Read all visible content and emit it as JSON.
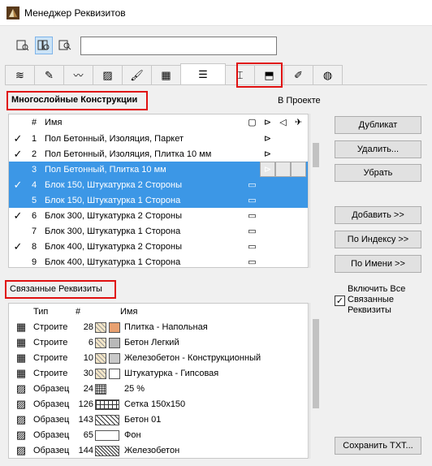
{
  "window": {
    "title": "Менеджер Реквизитов"
  },
  "search": {
    "value": ""
  },
  "top_section": {
    "title": "Многослойные Конструкции",
    "hint": "В Проекте"
  },
  "list_header": {
    "num": "#",
    "name": "Имя"
  },
  "items": [
    {
      "checked": true,
      "num": "1",
      "name": "Пол Бетонный, Изоляция, Паркет",
      "selected": false,
      "icon": "eye"
    },
    {
      "checked": true,
      "num": "2",
      "name": "Пол Бетонный, Изоляция, Плитка 10 мм",
      "selected": false,
      "icon": "eye"
    },
    {
      "checked": false,
      "num": "3",
      "name": "Пол Бетонный, Плитка 10 мм",
      "selected": true,
      "icon": "eye"
    },
    {
      "checked": true,
      "num": "4",
      "name": "Блок 150, Штукатурка 2 Стороны",
      "selected": true,
      "icon": "wall"
    },
    {
      "checked": false,
      "num": "5",
      "name": "Блок 150, Штукатурка 1 Сторона",
      "selected": true,
      "icon": "wall"
    },
    {
      "checked": true,
      "num": "6",
      "name": "Блок 300, Штукатурка 2 Стороны",
      "selected": false,
      "icon": "wall"
    },
    {
      "checked": false,
      "num": "7",
      "name": "Блок 300, Штукатурка 1 Сторона",
      "selected": false,
      "icon": "wall"
    },
    {
      "checked": true,
      "num": "8",
      "name": "Блок 400, Штукатурка 2 Стороны",
      "selected": false,
      "icon": "wall"
    },
    {
      "checked": false,
      "num": "9",
      "name": "Блок 400, Штукатурка 1 Сторона",
      "selected": false,
      "icon": "wall"
    }
  ],
  "buttons": {
    "duplicate": "Дубликат",
    "delete": "Удалить...",
    "remove": "Убрать",
    "add": "Добавить >>",
    "by_index": "По Индексу >>",
    "by_name": "По Имени >>",
    "save_txt": "Сохранить TXT..."
  },
  "bottom_section": {
    "title": "Связанные Реквизиты",
    "include_all_label": "Включить Все Связанные Реквизиты",
    "include_all_checked": true
  },
  "related_header": {
    "type": "Тип",
    "num": "#",
    "name": "Имя"
  },
  "related": [
    {
      "type": "Строите",
      "num": "28",
      "name": "Плитка - Напольная",
      "icon": "building-material-icon",
      "swatch": "#e8a070"
    },
    {
      "type": "Строите",
      "num": "6",
      "name": "Бетон Легкий",
      "icon": "building-material-icon",
      "swatch": "#b8b8b8"
    },
    {
      "type": "Строите",
      "num": "10",
      "name": "Железобетон - Конструкционный",
      "icon": "building-material-icon",
      "swatch": "#c8c8c8"
    },
    {
      "type": "Строите",
      "num": "30",
      "name": "Штукатурка - Гипсовая",
      "icon": "building-material-icon",
      "swatch": "#ffffff"
    },
    {
      "type": "Образец",
      "num": "24",
      "name": "25 %",
      "icon": "fill-pattern-icon",
      "swatch": "dots"
    },
    {
      "type": "Образец",
      "num": "126",
      "name": "Сетка 150x150",
      "icon": "fill-pattern-icon",
      "swatch": "grid"
    },
    {
      "type": "Образец",
      "num": "143",
      "name": "Бетон 01",
      "icon": "fill-pattern-icon",
      "swatch": "hatch"
    },
    {
      "type": "Образец",
      "num": "65",
      "name": "Фон",
      "icon": "fill-pattern-icon",
      "swatch": "plain"
    },
    {
      "type": "Образец",
      "num": "144",
      "name": "Железобетон",
      "icon": "fill-pattern-icon",
      "swatch": "hatch2"
    }
  ],
  "colors": {
    "selection": "#3c97e6",
    "highlight": "#e01010",
    "accent_tab": "#cce4f7"
  }
}
